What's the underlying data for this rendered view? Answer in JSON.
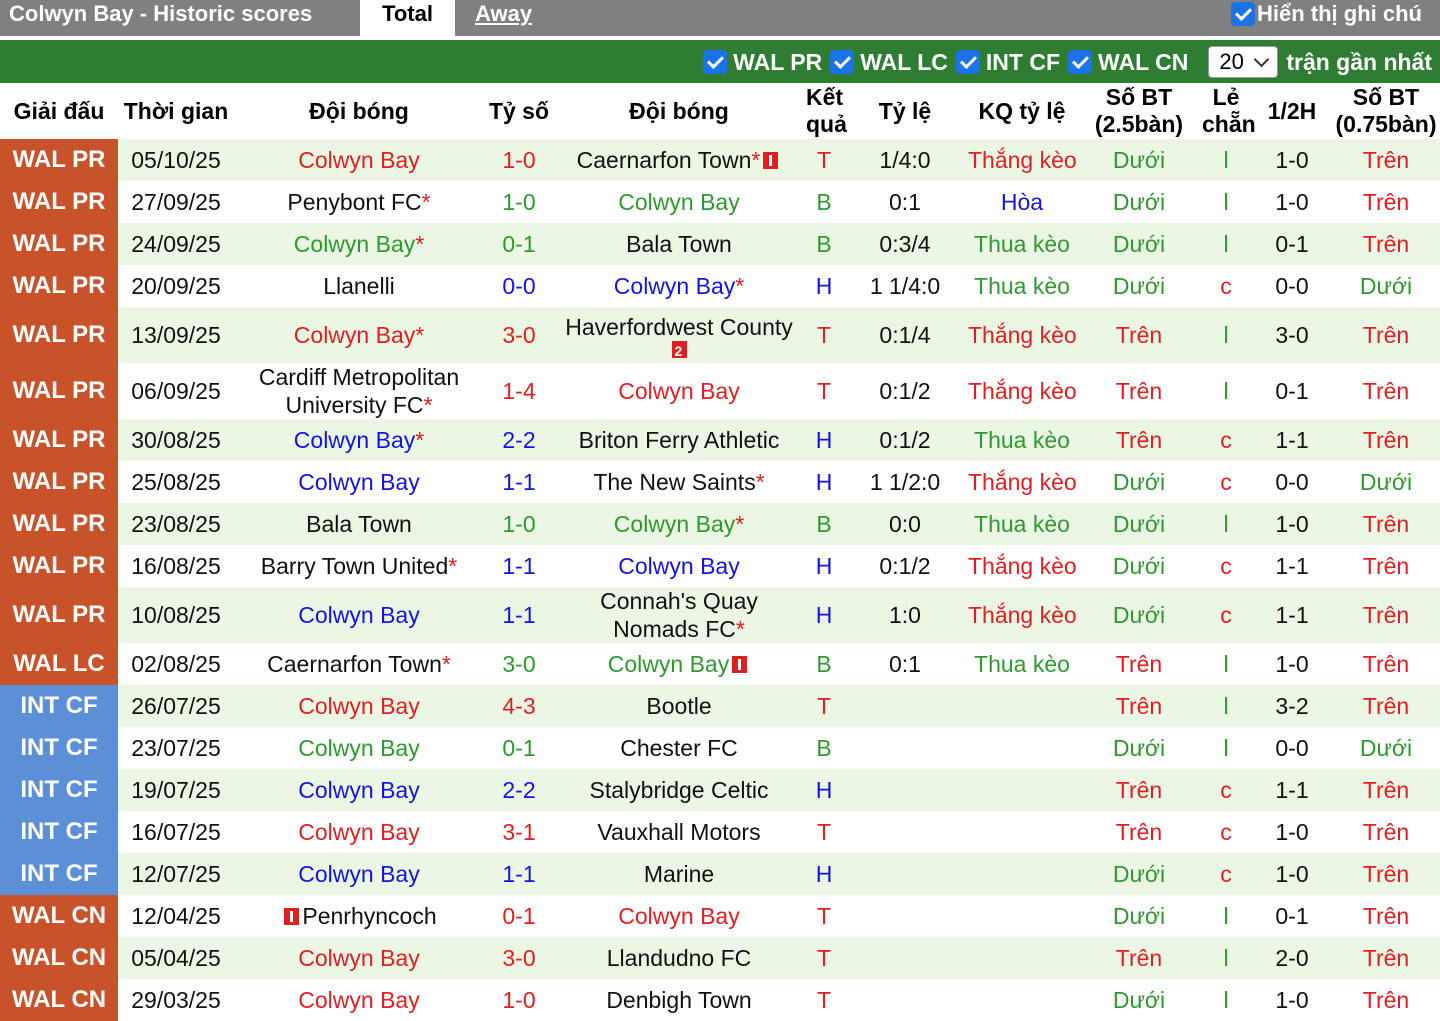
{
  "header": {
    "title": "Colwyn Bay - Historic scores",
    "tab_total": "Total",
    "tab_away": "Away",
    "show_notes": "Hiển thị ghi chú"
  },
  "filters": {
    "items": [
      "WAL PR",
      "WAL LC",
      "INT CF",
      "WAL CN"
    ],
    "count": "20",
    "suffix": "trận gần nhất"
  },
  "columns": [
    "Giải đấu",
    "Thời gian",
    "Đội bóng",
    "Tỷ số",
    "Đội bóng",
    "Kết quả",
    "Tỷ lệ",
    "KQ tỷ lệ",
    "Số BT (2.5bàn)",
    "Lẻ chẵn",
    "1/2H",
    "Số BT (0.75bàn)"
  ],
  "colors": {
    "win": "#e02020",
    "draw": "#1414e0",
    "loss": "#2e9a2e",
    "wal": "#c8532b",
    "int": "#5b8fd6",
    "header_green": "#2e7d32"
  },
  "rows": [
    {
      "league": "WAL PR",
      "date": "05/10/25",
      "home": "Colwyn Bay",
      "home_star": "",
      "home_card": "",
      "score": "1-0",
      "away": "Caernarfon Town",
      "away_star": "*",
      "away_card": "1",
      "res": "T",
      "odds": "1/4:0",
      "odds_res": "Thắng kèo",
      "ou": "Dưới",
      "oe": "l",
      "half": "1-0",
      "ou075": "Trên"
    },
    {
      "league": "WAL PR",
      "date": "27/09/25",
      "home": "Penybont FC",
      "home_star": "*",
      "home_card": "",
      "score": "1-0",
      "away": "Colwyn Bay",
      "away_star": "",
      "away_card": "",
      "res": "B",
      "odds": "0:1",
      "odds_res": "Hòa",
      "ou": "Dưới",
      "oe": "l",
      "half": "1-0",
      "ou075": "Trên"
    },
    {
      "league": "WAL PR",
      "date": "24/09/25",
      "home": "Colwyn Bay",
      "home_star": "*",
      "home_card": "",
      "score": "0-1",
      "away": "Bala Town",
      "away_star": "",
      "away_card": "",
      "res": "B",
      "odds": "0:3/4",
      "odds_res": "Thua kèo",
      "ou": "Dưới",
      "oe": "l",
      "half": "0-1",
      "ou075": "Trên"
    },
    {
      "league": "WAL PR",
      "date": "20/09/25",
      "home": "Llanelli",
      "home_star": "",
      "home_card": "",
      "score": "0-0",
      "away": "Colwyn Bay",
      "away_star": "*",
      "away_card": "",
      "res": "H",
      "odds": "1 1/4:0",
      "odds_res": "Thua kèo",
      "ou": "Dưới",
      "oe": "c",
      "half": "0-0",
      "ou075": "Dưới"
    },
    {
      "league": "WAL PR",
      "date": "13/09/25",
      "home": "Colwyn Bay",
      "home_star": "*",
      "home_card": "",
      "score": "3-0",
      "away": "Haverfordwest County",
      "away_star": "",
      "away_card": "2",
      "res": "T",
      "odds": "0:1/4",
      "odds_res": "Thắng kèo",
      "ou": "Trên",
      "oe": "l",
      "half": "3-0",
      "ou075": "Trên"
    },
    {
      "league": "WAL PR",
      "date": "06/09/25",
      "home": "Cardiff Metropolitan University FC",
      "home_star": "*",
      "home_card": "",
      "score": "1-4",
      "away": "Colwyn Bay",
      "away_star": "",
      "away_card": "",
      "res": "T",
      "odds": "0:1/2",
      "odds_res": "Thắng kèo",
      "ou": "Trên",
      "oe": "l",
      "half": "0-1",
      "ou075": "Trên"
    },
    {
      "league": "WAL PR",
      "date": "30/08/25",
      "home": "Colwyn Bay",
      "home_star": "*",
      "home_card": "",
      "score": "2-2",
      "away": "Briton Ferry Athletic",
      "away_star": "",
      "away_card": "",
      "res": "H",
      "odds": "0:1/2",
      "odds_res": "Thua kèo",
      "ou": "Trên",
      "oe": "c",
      "half": "1-1",
      "ou075": "Trên"
    },
    {
      "league": "WAL PR",
      "date": "25/08/25",
      "home": "Colwyn Bay",
      "home_star": "",
      "home_card": "",
      "score": "1-1",
      "away": "The New Saints",
      "away_star": "*",
      "away_card": "",
      "res": "H",
      "odds": "1 1/2:0",
      "odds_res": "Thắng kèo",
      "ou": "Dưới",
      "oe": "c",
      "half": "0-0",
      "ou075": "Dưới"
    },
    {
      "league": "WAL PR",
      "date": "23/08/25",
      "home": "Bala Town",
      "home_star": "",
      "home_card": "",
      "score": "1-0",
      "away": "Colwyn Bay",
      "away_star": "*",
      "away_card": "",
      "res": "B",
      "odds": "0:0",
      "odds_res": "Thua kèo",
      "ou": "Dưới",
      "oe": "l",
      "half": "1-0",
      "ou075": "Trên"
    },
    {
      "league": "WAL PR",
      "date": "16/08/25",
      "home": "Barry Town United",
      "home_star": "*",
      "home_card": "",
      "score": "1-1",
      "away": "Colwyn Bay",
      "away_star": "",
      "away_card": "",
      "res": "H",
      "odds": "0:1/2",
      "odds_res": "Thắng kèo",
      "ou": "Dưới",
      "oe": "c",
      "half": "1-1",
      "ou075": "Trên"
    },
    {
      "league": "WAL PR",
      "date": "10/08/25",
      "home": "Colwyn Bay",
      "home_star": "",
      "home_card": "",
      "score": "1-1",
      "away": "Connah's Quay Nomads FC",
      "away_star": "*",
      "away_card": "",
      "res": "H",
      "odds": "1:0",
      "odds_res": "Thắng kèo",
      "ou": "Dưới",
      "oe": "c",
      "half": "1-1",
      "ou075": "Trên"
    },
    {
      "league": "WAL LC",
      "date": "02/08/25",
      "home": "Caernarfon Town",
      "home_star": "*",
      "home_card": "",
      "score": "3-0",
      "away": "Colwyn Bay",
      "away_star": "",
      "away_card": "1",
      "res": "B",
      "odds": "0:1",
      "odds_res": "Thua kèo",
      "ou": "Trên",
      "oe": "l",
      "half": "1-0",
      "ou075": "Trên"
    },
    {
      "league": "INT CF",
      "date": "26/07/25",
      "home": "Colwyn Bay",
      "home_star": "",
      "home_card": "",
      "score": "4-3",
      "away": "Bootle",
      "away_star": "",
      "away_card": "",
      "res": "T",
      "odds": "",
      "odds_res": "",
      "ou": "Trên",
      "oe": "l",
      "half": "3-2",
      "ou075": "Trên"
    },
    {
      "league": "INT CF",
      "date": "23/07/25",
      "home": "Colwyn Bay",
      "home_star": "",
      "home_card": "",
      "score": "0-1",
      "away": "Chester FC",
      "away_star": "",
      "away_card": "",
      "res": "B",
      "odds": "",
      "odds_res": "",
      "ou": "Dưới",
      "oe": "l",
      "half": "0-0",
      "ou075": "Dưới"
    },
    {
      "league": "INT CF",
      "date": "19/07/25",
      "home": "Colwyn Bay",
      "home_star": "",
      "home_card": "",
      "score": "2-2",
      "away": "Stalybridge Celtic",
      "away_star": "",
      "away_card": "",
      "res": "H",
      "odds": "",
      "odds_res": "",
      "ou": "Trên",
      "oe": "c",
      "half": "1-1",
      "ou075": "Trên"
    },
    {
      "league": "INT CF",
      "date": "16/07/25",
      "home": "Colwyn Bay",
      "home_star": "",
      "home_card": "",
      "score": "3-1",
      "away": "Vauxhall Motors",
      "away_star": "",
      "away_card": "",
      "res": "T",
      "odds": "",
      "odds_res": "",
      "ou": "Trên",
      "oe": "c",
      "half": "1-0",
      "ou075": "Trên"
    },
    {
      "league": "INT CF",
      "date": "12/07/25",
      "home": "Colwyn Bay",
      "home_star": "",
      "home_card": "",
      "score": "1-1",
      "away": "Marine",
      "away_star": "",
      "away_card": "",
      "res": "H",
      "odds": "",
      "odds_res": "",
      "ou": "Dưới",
      "oe": "c",
      "half": "1-0",
      "ou075": "Trên"
    },
    {
      "league": "WAL CN",
      "date": "12/04/25",
      "home": "Penrhyncoch",
      "home_star": "",
      "home_card": "1",
      "score": "0-1",
      "away": "Colwyn Bay",
      "away_star": "",
      "away_card": "",
      "res": "T",
      "odds": "",
      "odds_res": "",
      "ou": "Dưới",
      "oe": "l",
      "half": "0-1",
      "ou075": "Trên"
    },
    {
      "league": "WAL CN",
      "date": "05/04/25",
      "home": "Colwyn Bay",
      "home_star": "",
      "home_card": "",
      "score": "3-0",
      "away": "Llandudno FC",
      "away_star": "",
      "away_card": "",
      "res": "T",
      "odds": "",
      "odds_res": "",
      "ou": "Trên",
      "oe": "l",
      "half": "2-0",
      "ou075": "Trên"
    },
    {
      "league": "WAL CN",
      "date": "29/03/25",
      "home": "Colwyn Bay",
      "home_star": "",
      "home_card": "",
      "score": "1-0",
      "away": "Denbigh Town",
      "away_star": "",
      "away_card": "",
      "res": "T",
      "odds": "",
      "odds_res": "",
      "ou": "Dưới",
      "oe": "l",
      "half": "1-0",
      "ou075": "Trên"
    }
  ]
}
